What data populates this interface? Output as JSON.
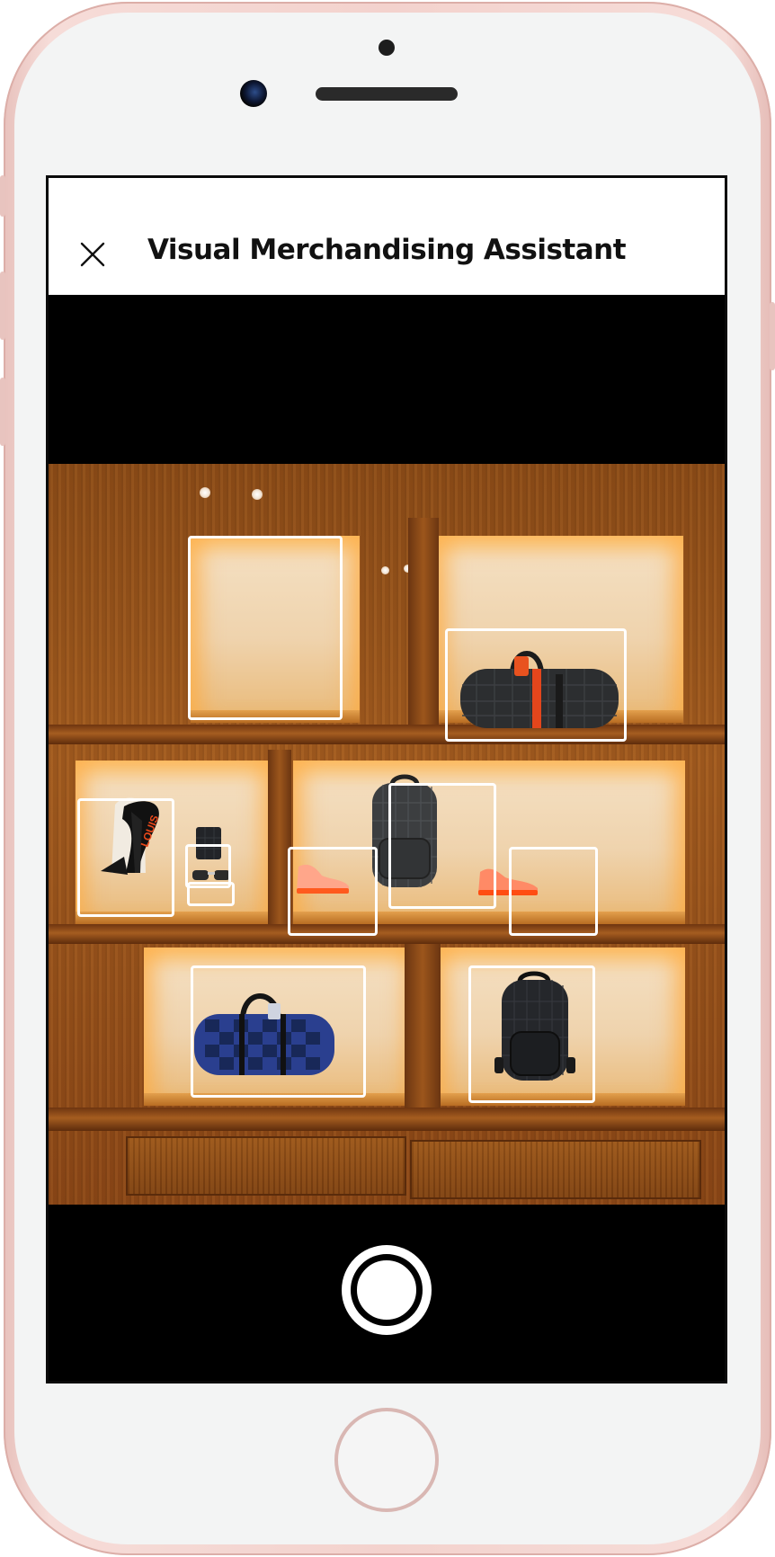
{
  "app": {
    "title": "Visual Merchandising Assistant"
  },
  "icons": {
    "close": "close-icon",
    "shutter": "shutter-icon"
  },
  "colors": {
    "header_bg": "#ffffff",
    "screen_bg": "#000000",
    "detection_box": "#ffffff",
    "phone_frame": "#f3d2cd"
  },
  "detections": [
    {
      "label": "empty-shelf-slot"
    },
    {
      "label": "duffle-bag-damier-orange"
    },
    {
      "label": "scarf-on-stand"
    },
    {
      "label": "phone-case"
    },
    {
      "label": "sunglasses"
    },
    {
      "label": "sneaker-pink-left"
    },
    {
      "label": "backpack-damier-grey"
    },
    {
      "label": "sneaker-pink-right"
    },
    {
      "label": "duffle-bag-damier-blue"
    },
    {
      "label": "backpack-damier-black"
    }
  ]
}
